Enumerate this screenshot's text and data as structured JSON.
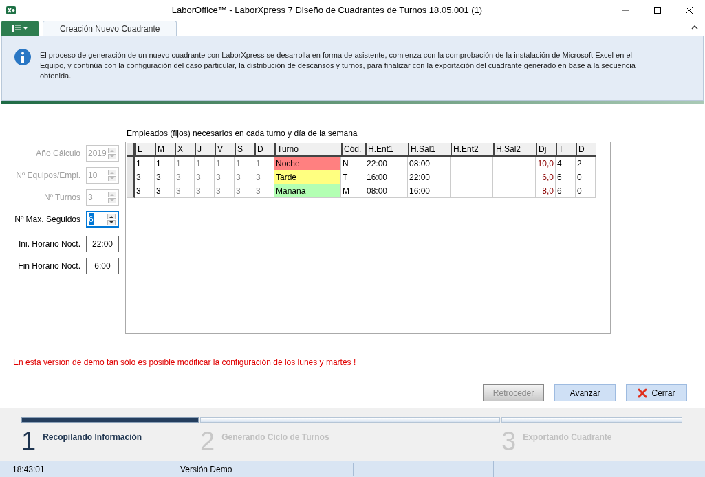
{
  "window": {
    "title": "LaborOffice™ - LaborXpress 7 Diseño de Cuadrantes de Turnos 18.05.001 (1)"
  },
  "tabs": [
    {
      "label": "Creación Nuevo Cuadrante",
      "selected": true
    }
  ],
  "info": {
    "text": "El proceso de generación de un nuevo cuadrante con LaborXpress se desarrolla en forma de asistente, comienza con la comprobación de la instalación de Microsoft Excel en el Equipo, y continúa con la configuración del caso particular, la distribución de descansos y turnos, para finalizar con la exportación del cuadrante generado en base a la secuencia obtenida."
  },
  "form": [
    {
      "label": "Año Cálculo",
      "value": "2019",
      "kind": "spinner",
      "disabled": true,
      "focused": false
    },
    {
      "label": "Nº Equipos/Empl.",
      "value": "10",
      "kind": "spinner",
      "disabled": true,
      "focused": false
    },
    {
      "label": "Nº Turnos",
      "value": "3",
      "kind": "spinner",
      "disabled": true,
      "focused": false
    },
    {
      "label": "Nº Max. Seguidos",
      "value": "6",
      "kind": "spinner",
      "disabled": false,
      "focused": true
    },
    {
      "label": "Ini. Horario Noct.",
      "value": "22:00",
      "kind": "time",
      "disabled": false
    },
    {
      "label": "Fin Horario Noct.",
      "value": "6:00",
      "kind": "time",
      "disabled": false
    }
  ],
  "table": {
    "caption": "Empleados (fijos) necesarios en cada turno y día de la semana",
    "columns": [
      {
        "label": "L",
        "kind": "day",
        "disabled": false
      },
      {
        "label": "M",
        "kind": "day",
        "disabled": false
      },
      {
        "label": "X",
        "kind": "day",
        "disabled": true
      },
      {
        "label": "J",
        "kind": "day",
        "disabled": true
      },
      {
        "label": "V",
        "kind": "day",
        "disabled": true
      },
      {
        "label": "S",
        "kind": "day",
        "disabled": true
      },
      {
        "label": "D",
        "kind": "day",
        "disabled": true
      },
      {
        "label": "Turno",
        "kind": "shift"
      },
      {
        "label": "Cód.",
        "kind": "code"
      },
      {
        "label": "H.Ent1",
        "kind": "time"
      },
      {
        "label": "H.Sal1",
        "kind": "time"
      },
      {
        "label": "H.Ent2",
        "kind": "time"
      },
      {
        "label": "H.Sal2",
        "kind": "time"
      },
      {
        "label": "Dj",
        "kind": "hours"
      },
      {
        "label": "T",
        "kind": "day",
        "disabled": false
      },
      {
        "label": "D",
        "kind": "day",
        "disabled": false
      }
    ],
    "rows": [
      {
        "color": "#ff8080",
        "cells": [
          "1",
          "1",
          "1",
          "1",
          "1",
          "1",
          "1",
          "Noche",
          "N",
          "22:00",
          "08:00",
          "",
          "",
          "10,0",
          "4",
          "2"
        ]
      },
      {
        "color": "#ffff80",
        "cells": [
          "3",
          "3",
          "3",
          "3",
          "3",
          "3",
          "3",
          "Tarde",
          "T",
          "16:00",
          "22:00",
          "",
          "",
          "6,0",
          "6",
          "0"
        ]
      },
      {
        "color": "#b3ffb3",
        "cells": [
          "3",
          "3",
          "3",
          "3",
          "3",
          "3",
          "3",
          "Mañana",
          "M",
          "08:00",
          "16:00",
          "",
          "",
          "8,0",
          "6",
          "0"
        ]
      }
    ]
  },
  "warning": "En esta versión de demo tan sólo es posible modificar la configuración de los lunes y martes !",
  "buttons": [
    {
      "label": "Retroceder",
      "kind": "plain",
      "disabled": true
    },
    {
      "label": "Avanzar",
      "kind": "plain",
      "disabled": false
    },
    {
      "label": "Cerrar",
      "kind": "close",
      "disabled": false
    }
  ],
  "steps": [
    {
      "number": "1",
      "label": "Recopilando Información",
      "selected": true
    },
    {
      "number": "2",
      "label": "Generando Ciclo de Turnos",
      "selected": false
    },
    {
      "number": "3",
      "label": "Exportando Cuadrante",
      "selected": false
    }
  ],
  "status_bar": {
    "time": "18:43:01",
    "edition": "Versión Demo"
  }
}
